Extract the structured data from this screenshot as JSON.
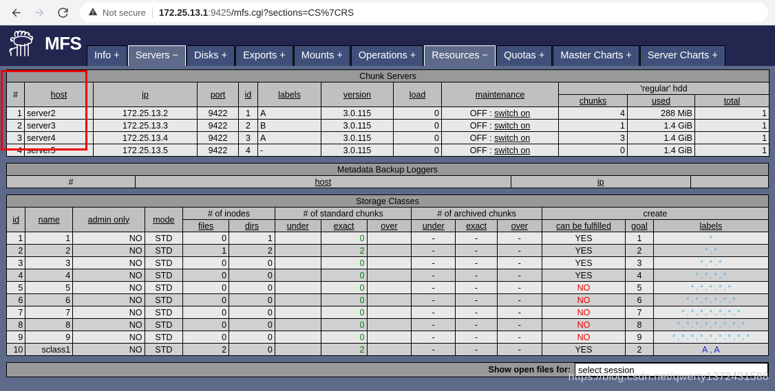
{
  "browser": {
    "back_icon": "arrow-left-icon",
    "forward_icon": "arrow-right-icon",
    "reload_icon": "reload-icon",
    "security_icon": "warning-triangle-icon",
    "security_label": "Not secure",
    "url_host": "172.25.13.1",
    "url_port": ":9425",
    "url_path": "/mfs.cgi?sections=CS%7CRS",
    "url_full": "172.25.13.1:9425/mfs.cgi?sections=CS%7CRS"
  },
  "header": {
    "logo_text": "MFS",
    "logo_icon": "moose-logo-icon",
    "brand_bg": "#23264f",
    "tabs": [
      {
        "label": "Info +",
        "active": false
      },
      {
        "label": "Servers −",
        "active": true
      },
      {
        "label": "Disks +",
        "active": false
      },
      {
        "label": "Exports +",
        "active": false
      },
      {
        "label": "Mounts +",
        "active": false
      },
      {
        "label": "Operations +",
        "active": false
      },
      {
        "label": "Resources −",
        "active": true
      },
      {
        "label": "Quotas +",
        "active": false
      },
      {
        "label": "Master Charts +",
        "active": false
      },
      {
        "label": "Server Charts +",
        "active": false
      }
    ]
  },
  "chunk_servers": {
    "title": "Chunk Servers",
    "group_hdd": "'regular' hdd",
    "columns": [
      "#",
      "host",
      "ip",
      "port",
      "id",
      "labels",
      "version",
      "load",
      "maintenance",
      "chunks",
      "used",
      "total"
    ],
    "maintenance_state": "OFF :",
    "maintenance_action": "switch on",
    "rows": [
      {
        "num": "1",
        "host": "server2",
        "ip": "172.25.13.2",
        "port": "9422",
        "id": "1",
        "labels": "A",
        "version": "3.0.115",
        "load": "0",
        "maint_state": "OFF :",
        "maint_action": "switch on",
        "chunks": "4",
        "used": "288 MiB",
        "total": "1"
      },
      {
        "num": "2",
        "host": "server3",
        "ip": "172.25.13.3",
        "port": "9422",
        "id": "2",
        "labels": "B",
        "version": "3.0.115",
        "load": "0",
        "maint_state": "OFF :",
        "maint_action": "switch on",
        "chunks": "1",
        "used": "1.4 GiB",
        "total": "1"
      },
      {
        "num": "3",
        "host": "server4",
        "ip": "172.25.13.4",
        "port": "9422",
        "id": "3",
        "labels": "A",
        "version": "3.0.115",
        "load": "0",
        "maint_state": "OFF :",
        "maint_action": "switch on",
        "chunks": "3",
        "used": "1.4 GiB",
        "total": "1"
      },
      {
        "num": "4",
        "host": "server5",
        "ip": "172.25.13.5",
        "port": "9422",
        "id": "4",
        "labels": "-",
        "version": "3.0.115",
        "load": "0",
        "maint_state": "OFF :",
        "maint_action": "switch on",
        "chunks": "0",
        "used": "1.4 GiB",
        "total": "1"
      }
    ]
  },
  "metadata_backup_loggers": {
    "title": "Metadata Backup Loggers",
    "columns": [
      "#",
      "host",
      "ip",
      ""
    ],
    "rows": []
  },
  "storage_classes": {
    "title": "Storage Classes",
    "group_inodes": "# of inodes",
    "group_standard": "# of standard chunks",
    "group_archived": "# of archived chunks",
    "group_create": "create",
    "columns": [
      "id",
      "name",
      "admin only",
      "mode",
      "files",
      "dirs",
      "under",
      "exact",
      "over",
      "under",
      "exact",
      "over",
      "can be fulfilled",
      "goal",
      "labels"
    ],
    "rows": [
      {
        "id": "1",
        "name": "1",
        "admin_only": "NO",
        "mode": "STD",
        "files": "0",
        "dirs": "1",
        "std_under": "",
        "std_exact": "0",
        "std_over": "",
        "arch_under": "-",
        "arch_exact": "-",
        "arch_over": "-",
        "fulfilled": "YES",
        "goal": "1",
        "labels": "*",
        "label_count": 1,
        "label_kind": "star"
      },
      {
        "id": "2",
        "name": "2",
        "admin_only": "NO",
        "mode": "STD",
        "files": "1",
        "dirs": "2",
        "std_under": "",
        "std_exact": "2",
        "std_over": "",
        "arch_under": "-",
        "arch_exact": "-",
        "arch_over": "-",
        "fulfilled": "YES",
        "goal": "2",
        "labels": "* , *",
        "label_count": 2,
        "label_kind": "star"
      },
      {
        "id": "3",
        "name": "3",
        "admin_only": "NO",
        "mode": "STD",
        "files": "0",
        "dirs": "0",
        "std_under": "",
        "std_exact": "0",
        "std_over": "",
        "arch_under": "-",
        "arch_exact": "-",
        "arch_over": "-",
        "fulfilled": "YES",
        "goal": "3",
        "labels": "* , * , *",
        "label_count": 3,
        "label_kind": "star"
      },
      {
        "id": "4",
        "name": "4",
        "admin_only": "NO",
        "mode": "STD",
        "files": "0",
        "dirs": "0",
        "std_under": "",
        "std_exact": "0",
        "std_over": "",
        "arch_under": "-",
        "arch_exact": "-",
        "arch_over": "-",
        "fulfilled": "YES",
        "goal": "4",
        "labels": "* , * , * , *",
        "label_count": 4,
        "label_kind": "star"
      },
      {
        "id": "5",
        "name": "5",
        "admin_only": "NO",
        "mode": "STD",
        "files": "0",
        "dirs": "0",
        "std_under": "",
        "std_exact": "0",
        "std_over": "",
        "arch_under": "-",
        "arch_exact": "-",
        "arch_over": "-",
        "fulfilled": "NO",
        "goal": "5",
        "labels": "* , * , * , * , *",
        "label_count": 5,
        "label_kind": "star"
      },
      {
        "id": "6",
        "name": "6",
        "admin_only": "NO",
        "mode": "STD",
        "files": "0",
        "dirs": "0",
        "std_under": "",
        "std_exact": "0",
        "std_over": "",
        "arch_under": "-",
        "arch_exact": "-",
        "arch_over": "-",
        "fulfilled": "NO",
        "goal": "6",
        "labels": "* , * , * , * , * , *",
        "label_count": 6,
        "label_kind": "star"
      },
      {
        "id": "7",
        "name": "7",
        "admin_only": "NO",
        "mode": "STD",
        "files": "0",
        "dirs": "0",
        "std_under": "",
        "std_exact": "0",
        "std_over": "",
        "arch_under": "-",
        "arch_exact": "-",
        "arch_over": "-",
        "fulfilled": "NO",
        "goal": "7",
        "labels": "* , * , * , * , * , * , *",
        "label_count": 7,
        "label_kind": "star"
      },
      {
        "id": "8",
        "name": "8",
        "admin_only": "NO",
        "mode": "STD",
        "files": "0",
        "dirs": "0",
        "std_under": "",
        "std_exact": "0",
        "std_over": "",
        "arch_under": "-",
        "arch_exact": "-",
        "arch_over": "-",
        "fulfilled": "NO",
        "goal": "8",
        "labels": "* , * , * , * , * , * , * , *",
        "label_count": 8,
        "label_kind": "star"
      },
      {
        "id": "9",
        "name": "9",
        "admin_only": "NO",
        "mode": "STD",
        "files": "0",
        "dirs": "0",
        "std_under": "",
        "std_exact": "0",
        "std_over": "",
        "arch_under": "-",
        "arch_exact": "-",
        "arch_over": "-",
        "fulfilled": "NO",
        "goal": "9",
        "labels": "* , * , * , * , * , * , * , * , *",
        "label_count": 9,
        "label_kind": "star"
      },
      {
        "id": "10",
        "name": "sclass1",
        "admin_only": "NO",
        "mode": "STD",
        "files": "2",
        "dirs": "0",
        "std_under": "",
        "std_exact": "2",
        "std_over": "",
        "arch_under": "-",
        "arch_exact": "-",
        "arch_over": "-",
        "fulfilled": "YES",
        "goal": "2",
        "labels": "A , A",
        "label_count": 2,
        "label_kind": "letter"
      }
    ]
  },
  "open_files": {
    "label": "Show open files for:",
    "select_value": "select session"
  },
  "watermark": "https://blog.csdn.net/qwerty1372431588",
  "annotation": {
    "redbox_color": "#ee0000"
  }
}
